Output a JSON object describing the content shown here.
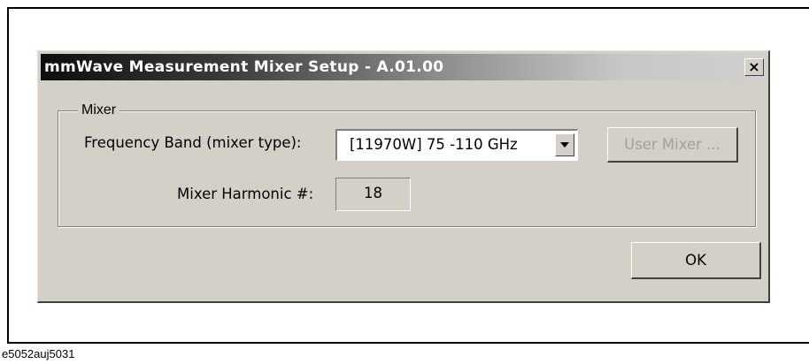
{
  "dialog": {
    "title": "mmWave Measurement Mixer Setup - A.01.00",
    "close_glyph": "×",
    "close_icon": "close-icon"
  },
  "mixer_group": {
    "legend": "Mixer",
    "frequency_band_label": "Frequency Band (mixer type):",
    "frequency_band_value": "[11970W] 75 -110  GHz",
    "user_mixer_label": "User Mixer ...",
    "user_mixer_enabled": false,
    "harmonic_label": "Mixer Harmonic #:",
    "harmonic_value": "18"
  },
  "footer": {
    "ok_label": "OK"
  },
  "caption": "e5052auj5031"
}
